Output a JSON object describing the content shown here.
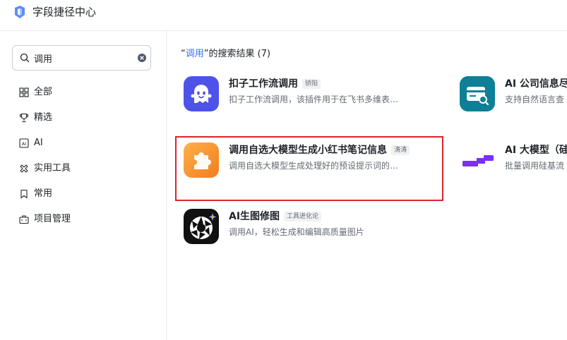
{
  "app": {
    "title": "字段捷径中心"
  },
  "search": {
    "value": "调用",
    "placeholder": ""
  },
  "sidebar": {
    "items": [
      {
        "label": "全部",
        "icon": "grid-icon"
      },
      {
        "label": "精选",
        "icon": "trophy-icon"
      },
      {
        "label": "AI",
        "icon": "ai-icon"
      },
      {
        "label": "实用工具",
        "icon": "tools-icon"
      },
      {
        "label": "常用",
        "icon": "bookmark-icon"
      },
      {
        "label": "项目管理",
        "icon": "briefcase-icon"
      }
    ]
  },
  "results": {
    "prefix": "“",
    "query": "调用",
    "suffix": "”的搜索结果 (7)"
  },
  "cards": [
    {
      "title": "扣子工作流调用",
      "tag": "骄阳",
      "desc": "扣子工作流调用，该插件用于在飞书多维表…",
      "icon": "ghost-icon"
    },
    {
      "title": "AI 公司信息尽",
      "tag": "",
      "desc": "支持自然语言查",
      "icon": "company-search-icon"
    },
    {
      "title": "调用自选大模型生成小红书笔记信息",
      "tag": "涛涛",
      "desc": "调用自选大模型生成处理好的预设提示词的…",
      "icon": "puzzle-icon"
    },
    {
      "title": "AI 大模型（硅",
      "tag": "",
      "desc": "批量调用硅基流",
      "icon": "siliconflow-icon"
    },
    {
      "title": "AI生图修图",
      "tag": "工具进化论",
      "desc": "调用AI，轻松生成和编辑高质量图片",
      "icon": "aperture-icon"
    }
  ],
  "colors": {
    "accent": "#3370ff",
    "highlight": "#d6262e"
  }
}
